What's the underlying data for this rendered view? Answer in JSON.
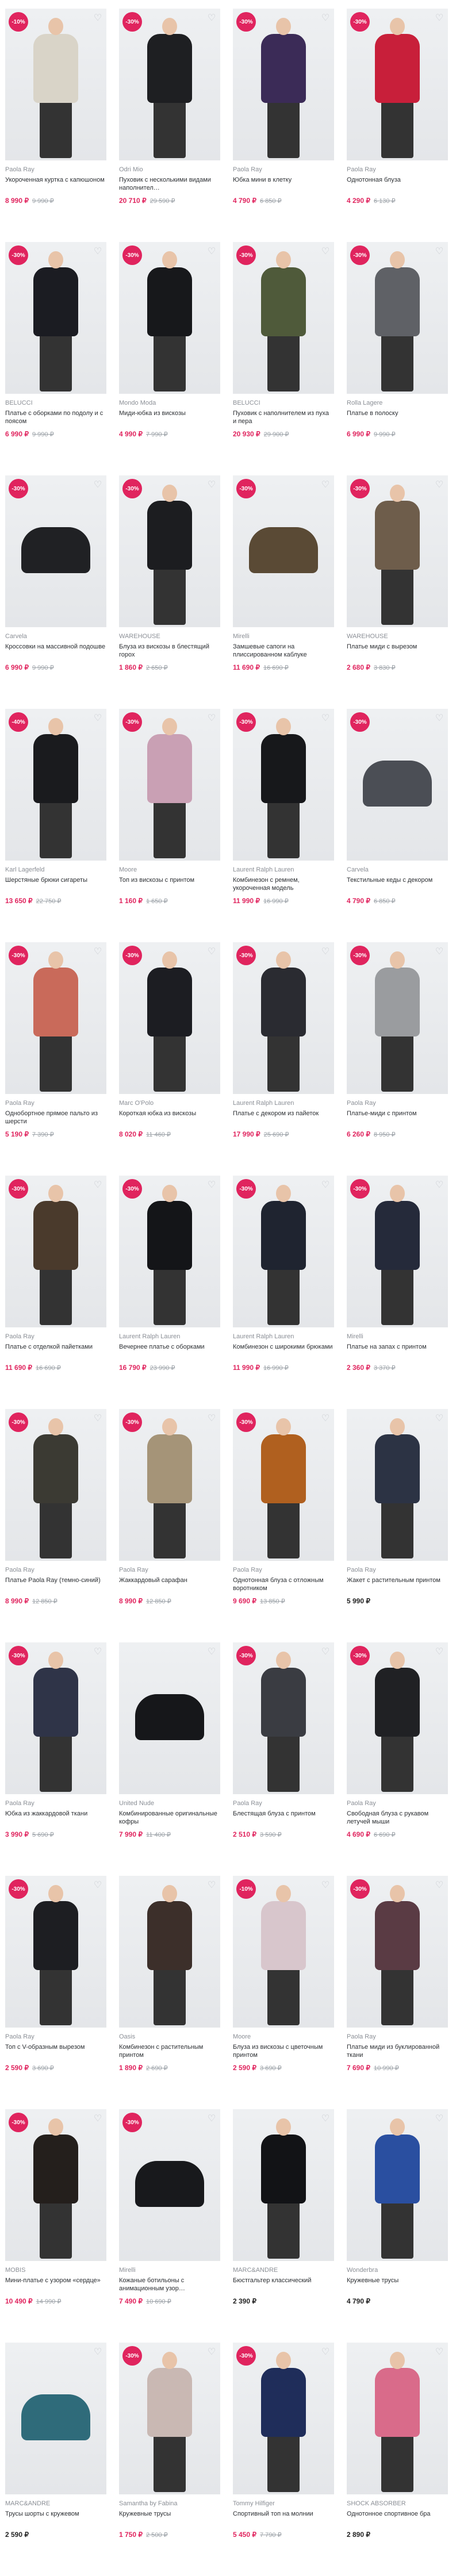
{
  "products": [
    {
      "discount": "-10%",
      "brand": "Paola Ray",
      "title": "Укороченная куртка с капюшоном",
      "price": "8 990 ₽",
      "old": "9 990 ₽",
      "color": "#d9d4c8",
      "kind": "person"
    },
    {
      "discount": "-30%",
      "brand": "Odri Mio",
      "title": "Пуховик с несколькими видами наполнител…",
      "price": "20 710 ₽",
      "old": "29 590 ₽",
      "color": "#1e1f22",
      "kind": "person"
    },
    {
      "discount": "-30%",
      "brand": "Paola Ray",
      "title": "Юбка мини в клетку",
      "price": "4 790 ₽",
      "old": "6 850 ₽",
      "color": "#3b2b57",
      "kind": "person"
    },
    {
      "discount": "-30%",
      "brand": "Paola Ray",
      "title": "Однотонная блуза",
      "price": "4 290 ₽",
      "old": "6 130 ₽",
      "color": "#c81f3a",
      "kind": "person"
    },
    {
      "discount": "-30%",
      "brand": "BELUCCI",
      "title": "Платье с оборками по подолу и с поясом",
      "price": "6 990 ₽",
      "old": "9 990 ₽",
      "color": "#1b1c22",
      "kind": "person"
    },
    {
      "discount": "-30%",
      "brand": "Mondo Moda",
      "title": "Миди-юбка из вискозы",
      "price": "4 990 ₽",
      "old": "7 990 ₽",
      "color": "#17181b",
      "kind": "person"
    },
    {
      "discount": "-30%",
      "brand": "BELUCCI",
      "title": "Пуховик с наполнителем из пуха и пера",
      "price": "20 930 ₽",
      "old": "29 900 ₽",
      "color": "#4f5a3a",
      "kind": "person"
    },
    {
      "discount": "-30%",
      "brand": "Rolla Lagere",
      "title": "Платье в полоску",
      "price": "6 990 ₽",
      "old": "9 990 ₽",
      "color": "#5f6166",
      "kind": "person"
    },
    {
      "discount": "-30%",
      "brand": "Carvela",
      "title": "Кроссовки на массивной подошве",
      "price": "6 990 ₽",
      "old": "9 990 ₽",
      "color": "#202124",
      "kind": "product"
    },
    {
      "discount": "-30%",
      "brand": "WAREHOUSE",
      "title": "Блуза из вискозы в блестящий горох",
      "price": "1 860 ₽",
      "old": "2 650 ₽",
      "color": "#1c1d20",
      "kind": "person"
    },
    {
      "discount": "-30%",
      "brand": "Mirelli",
      "title": "Замшевые сапоги на плиссированном каблуке",
      "price": "11 690 ₽",
      "old": "16 690 ₽",
      "color": "#5a4a35",
      "kind": "product"
    },
    {
      "discount": "-30%",
      "brand": "WAREHOUSE",
      "title": "Платье миди с вырезом",
      "price": "2 680 ₽",
      "old": "3 830 ₽",
      "color": "#6e5d4b",
      "kind": "person"
    },
    {
      "discount": "-40%",
      "brand": "Karl Lagerfeld",
      "title": "Шерстяные брюки сигареты",
      "price": "13 650 ₽",
      "old": "22 750 ₽",
      "color": "#1a1b1e",
      "kind": "person"
    },
    {
      "discount": "-30%",
      "brand": "Moore",
      "title": "Топ из вискозы с принтом",
      "price": "1 160 ₽",
      "old": "1 650 ₽",
      "color": "#c9a0b4",
      "kind": "person"
    },
    {
      "discount": "-30%",
      "brand": "Laurent Ralph Lauren",
      "title": "Комбинезон с ремнем, укороченная модель",
      "price": "11 990 ₽",
      "old": "16 990 ₽",
      "color": "#17181b",
      "kind": "person"
    },
    {
      "discount": "-30%",
      "brand": "Carvela",
      "title": "Текстильные кеды с декором",
      "price": "4 790 ₽",
      "old": "6 850 ₽",
      "color": "#4b4e55",
      "kind": "product"
    },
    {
      "discount": "-30%",
      "brand": "Paola Ray",
      "title": "Однобортное прямое пальто из шерсти",
      "price": "5 190 ₽",
      "old": "7 390 ₽",
      "color": "#c96a5a",
      "kind": "person"
    },
    {
      "discount": "-30%",
      "brand": "Marc O'Polo",
      "title": "Короткая юбка из вискозы",
      "price": "8 020 ₽",
      "old": "11 460 ₽",
      "color": "#1c1d22",
      "kind": "person"
    },
    {
      "discount": "-30%",
      "brand": "Laurent Ralph Lauren",
      "title": "Платье с декором из пайеток",
      "price": "17 990 ₽",
      "old": "25 690 ₽",
      "color": "#2a2b31",
      "kind": "person"
    },
    {
      "discount": "-30%",
      "brand": "Paola Ray",
      "title": "Платье-миди с принтом",
      "price": "6 260 ₽",
      "old": "8 950 ₽",
      "color": "#9a9c9f",
      "kind": "person"
    },
    {
      "discount": "-30%",
      "brand": "Paola Ray",
      "title": "Платье с отделкой пайетками",
      "price": "11 690 ₽",
      "old": "16 690 ₽",
      "color": "#4a3a2c",
      "kind": "person"
    },
    {
      "discount": "-30%",
      "brand": "Laurent Ralph Lauren",
      "title": "Вечернее платье с оборками",
      "price": "16 790 ₽",
      "old": "23 990 ₽",
      "color": "#141518",
      "kind": "person"
    },
    {
      "discount": "-30%",
      "brand": "Laurent Ralph Lauren",
      "title": "Комбинезон с широкими брюками",
      "price": "11 990 ₽",
      "old": "16 990 ₽",
      "color": "#1f2430",
      "kind": "person"
    },
    {
      "discount": "-30%",
      "brand": "Mirelli",
      "title": "Платье на запах с принтом",
      "price": "2 360 ₽",
      "old": "3 370 ₽",
      "color": "#252a3a",
      "kind": "person"
    },
    {
      "discount": "-30%",
      "brand": "Paola Ray",
      "title": "Платье Paola Ray (темно-синий)",
      "price": "8 990 ₽",
      "old": "12 850 ₽",
      "color": "#3b3a33",
      "kind": "person"
    },
    {
      "discount": "-30%",
      "brand": "Paola Ray",
      "title": "Жаккардовый сарафан",
      "price": "8 990 ₽",
      "old": "12 850 ₽",
      "color": "#a59478",
      "kind": "person"
    },
    {
      "discount": "-30%",
      "brand": "Paola Ray",
      "title": "Однотонная блуза с отложным воротником",
      "price": "9 690 ₽",
      "old": "13 850 ₽",
      "color": "#b0601f",
      "kind": "person"
    },
    {
      "discount": "",
      "brand": "Paola Ray",
      "title": "Жакет с растительным принтом",
      "price": "5 990 ₽",
      "old": "",
      "color": "#2c3344",
      "kind": "person"
    },
    {
      "discount": "-30%",
      "brand": "Paola Ray",
      "title": "Юбка из жаккардовой ткани",
      "price": "3 990 ₽",
      "old": "5 690 ₽",
      "color": "#2f3448",
      "kind": "person"
    },
    {
      "discount": "",
      "brand": "United Nude",
      "title": "Комбинированные оригинальные кофры",
      "price": "7 990 ₽",
      "old": "11 400 ₽",
      "color": "#16171a",
      "kind": "product"
    },
    {
      "discount": "-30%",
      "brand": "Paola Ray",
      "title": "Блестящая блуза с принтом",
      "price": "2 510 ₽",
      "old": "3 590 ₽",
      "color": "#3a3c42",
      "kind": "person"
    },
    {
      "discount": "-30%",
      "brand": "Paola Ray",
      "title": "Свободная блуза с рукавом летучей мыши",
      "price": "4 690 ₽",
      "old": "6 690 ₽",
      "color": "#202124",
      "kind": "person"
    },
    {
      "discount": "-30%",
      "brand": "Paola Ray",
      "title": "Топ с V-образным вырезом",
      "price": "2 590 ₽",
      "old": "3 690 ₽",
      "color": "#1d1e22",
      "kind": "person"
    },
    {
      "discount": "",
      "brand": "Oasis",
      "title": "Комбинезон с растительным принтом",
      "price": "1 890 ₽",
      "old": "2 690 ₽",
      "color": "#3c2f2a",
      "kind": "person"
    },
    {
      "discount": "-10%",
      "brand": "Moore",
      "title": "Блуза из вискозы с цветочным принтом",
      "price": "2 590 ₽",
      "old": "3 690 ₽",
      "color": "#d8c6cc",
      "kind": "person"
    },
    {
      "discount": "-30%",
      "brand": "Paola Ray",
      "title": "Платье миди из буклированной ткани",
      "price": "7 690 ₽",
      "old": "10 990 ₽",
      "color": "#5a3b44",
      "kind": "person"
    },
    {
      "discount": "-30%",
      "brand": "MOBIS",
      "title": "Мини-платье с узором «сердце»",
      "price": "10 490 ₽",
      "old": "14 990 ₽",
      "color": "#241f1c",
      "kind": "person"
    },
    {
      "discount": "-30%",
      "brand": "Mirelli",
      "title": "Кожаные ботильоны с анимационным узор…",
      "price": "7 490 ₽",
      "old": "10 690 ₽",
      "color": "#18191c",
      "kind": "product"
    },
    {
      "discount": "",
      "brand": "MARC&ANDRE",
      "title": "Бюстгальтер классический",
      "price": "2 390 ₽",
      "old": "",
      "color": "#121316",
      "kind": "person"
    },
    {
      "discount": "",
      "brand": "Wonderbra",
      "title": "Кружевные трусы",
      "price": "4 790 ₽",
      "old": "",
      "color": "#2a4fa0",
      "kind": "person"
    },
    {
      "discount": "",
      "brand": "MARC&ANDRE",
      "title": "Трусы шорты с кружевом",
      "price": "2 590 ₽",
      "old": "",
      "color": "#2f6b7a",
      "kind": "product"
    },
    {
      "discount": "-30%",
      "brand": "Samantha by Fabina",
      "title": "Кружевные трусы",
      "price": "1 750 ₽",
      "old": "2 500 ₽",
      "color": "#c9b8b3",
      "kind": "person"
    },
    {
      "discount": "-30%",
      "brand": "Tommy Hilfiger",
      "title": "Спортивный топ на молнии",
      "price": "5 450 ₽",
      "old": "7 790 ₽",
      "color": "#1f2d5a",
      "kind": "person"
    },
    {
      "discount": "",
      "brand": "SHOCK ABSORBER",
      "title": "Однотонное спортивное бра",
      "price": "2 890 ₽",
      "old": "",
      "color": "#d96b8a",
      "kind": "person"
    }
  ]
}
